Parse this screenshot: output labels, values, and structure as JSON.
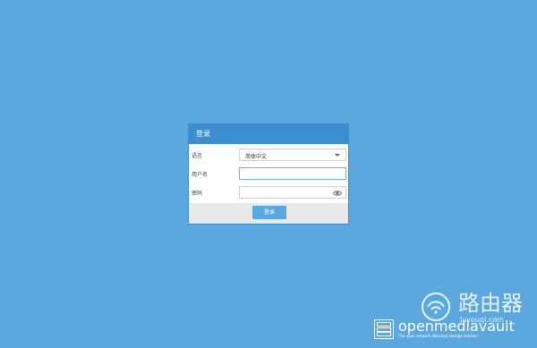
{
  "dialog": {
    "title": "登录",
    "language_label": "语言",
    "language_value": "简体中文",
    "username_label": "用户名",
    "username_value": "",
    "password_label": "密码",
    "password_value": "",
    "login_button": "登录"
  },
  "branding": {
    "name": "openmediavault",
    "tagline": "The open network attached storage solution"
  },
  "watermark": {
    "text": "路由器",
    "url": "luyouqi.com"
  },
  "colors": {
    "background": "#5aa8dd",
    "header": "#3b8fd0",
    "button": "#5aa8dd"
  }
}
